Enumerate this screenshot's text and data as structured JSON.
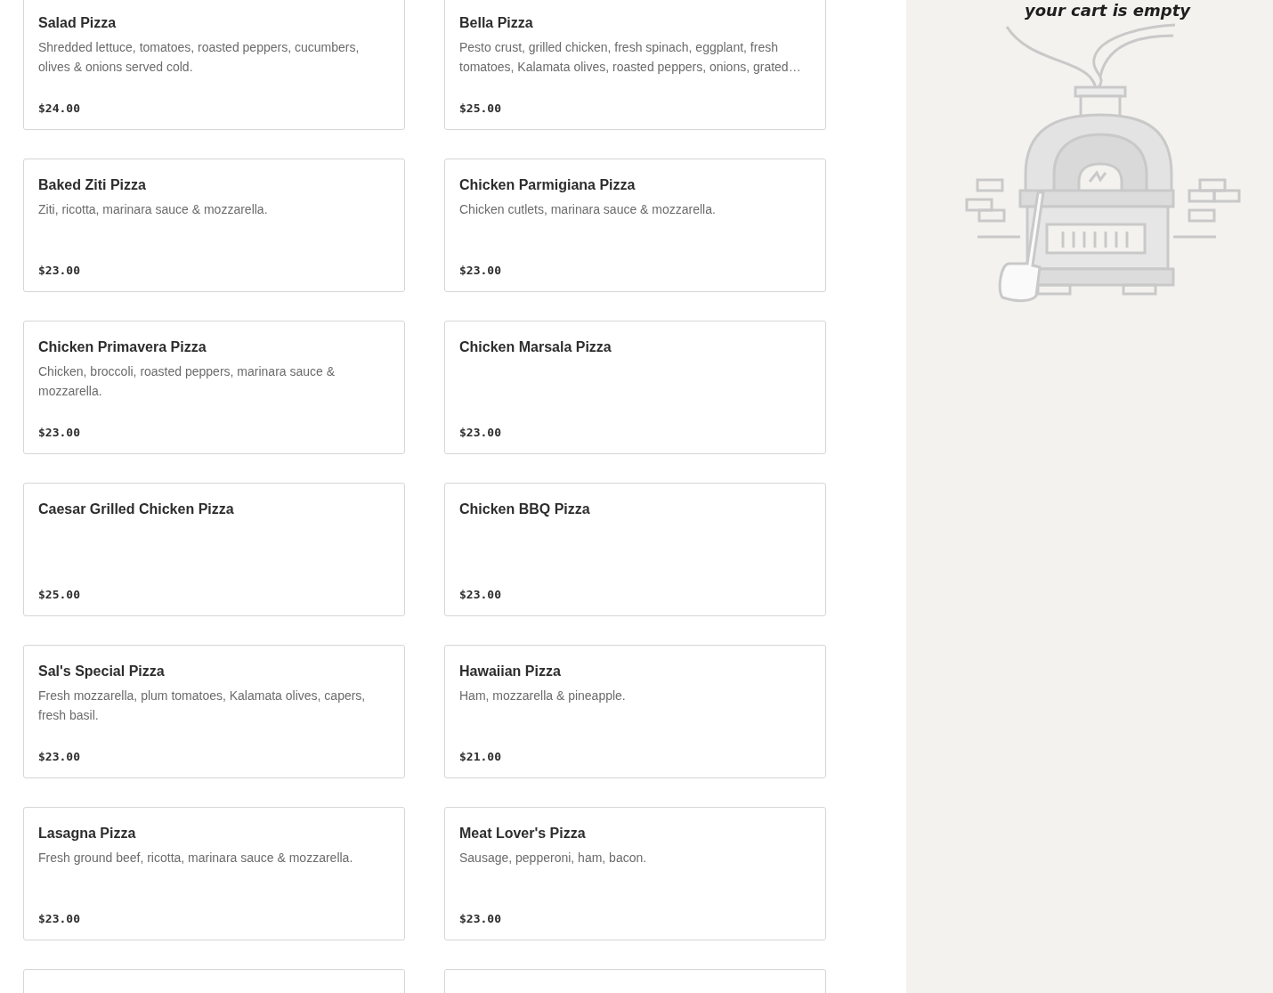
{
  "menu_items": [
    {
      "name": "Salad Pizza",
      "description": "Shredded lettuce, tomatoes, roasted peppers, cucumbers, olives & onions served cold.",
      "price": "$24.00"
    },
    {
      "name": "Bella Pizza",
      "description": "Pesto crust, grilled chicken, fresh spinach, eggplant, fresh tomatoes, Kalamata olives, roasted peppers, onions, grated…",
      "price": "$25.00"
    },
    {
      "name": "Baked Ziti Pizza",
      "description": "Ziti, ricotta, marinara sauce & mozzarella.",
      "price": "$23.00"
    },
    {
      "name": "Chicken Parmigiana Pizza",
      "description": "Chicken cutlets, marinara sauce & mozzarella.",
      "price": "$23.00"
    },
    {
      "name": "Chicken Primavera Pizza",
      "description": "Chicken, broccoli, roasted peppers, marinara sauce & mozzarella.",
      "price": "$23.00"
    },
    {
      "name": "Chicken Marsala Pizza",
      "price": "$23.00"
    },
    {
      "name": "Caesar Grilled Chicken Pizza",
      "price": "$25.00"
    },
    {
      "name": "Chicken BBQ Pizza",
      "price": "$23.00"
    },
    {
      "name": "Sal's Special Pizza",
      "description": "Fresh mozzarella, plum tomatoes, Kalamata olives, capers, fresh basil.",
      "price": "$23.00"
    },
    {
      "name": "Hawaiian Pizza",
      "description": "Ham, mozzarella & pineapple.",
      "price": "$21.00"
    },
    {
      "name": "Lasagna Pizza",
      "description": "Fresh ground beef, ricotta, marinara sauce & mozzarella.",
      "price": "$23.00"
    },
    {
      "name": "Meat Lover's Pizza",
      "description": "Sausage, pepperoni, ham, bacon.",
      "price": "$23.00"
    }
  ],
  "cart": {
    "message": "your cart is empty"
  }
}
